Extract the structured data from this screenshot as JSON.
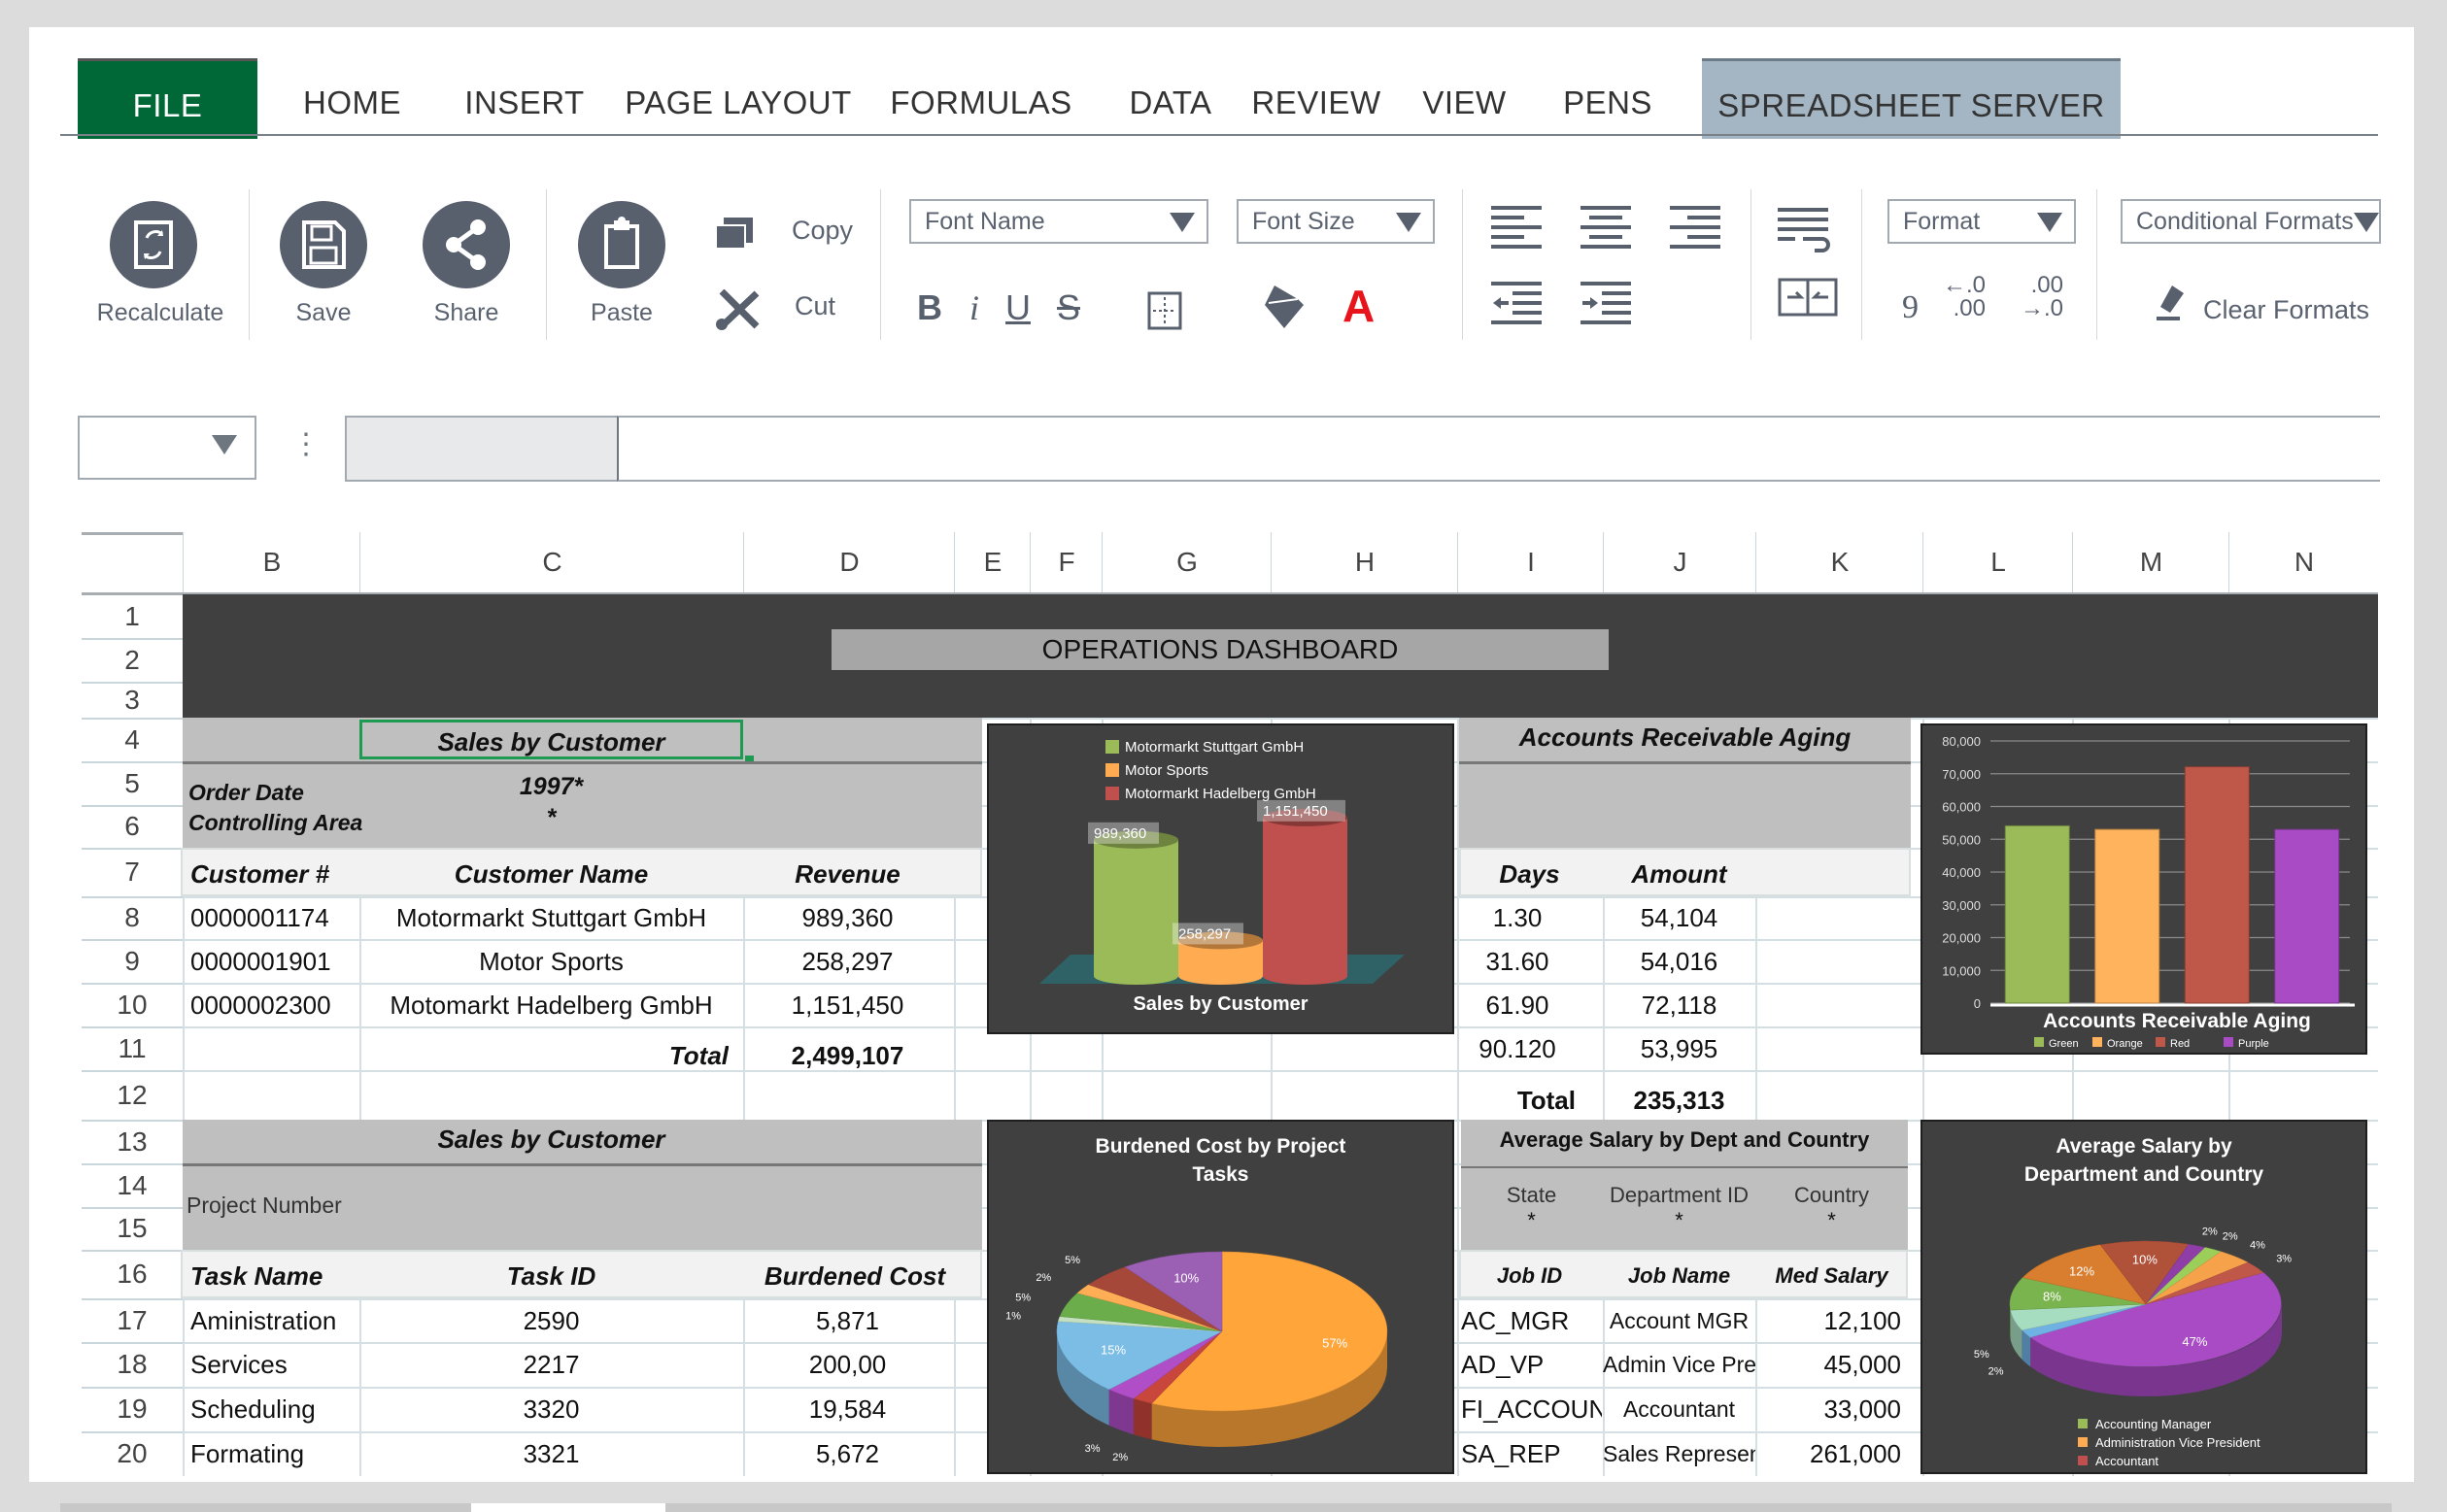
{
  "tabs": [
    {
      "label": "FILE",
      "state": "file"
    },
    {
      "label": "HOME"
    },
    {
      "label": "INSERT"
    },
    {
      "label": "PAGE LAYOUT"
    },
    {
      "label": "FORMULAS"
    },
    {
      "label": "DATA"
    },
    {
      "label": "REVIEW"
    },
    {
      "label": "VIEW"
    },
    {
      "label": "PENS"
    },
    {
      "label": "SPREADSHEET SERVER",
      "state": "active"
    }
  ],
  "ribbon": {
    "recalculate": "Recalculate",
    "save": "Save",
    "share": "Share",
    "paste": "Paste",
    "copy": "Copy",
    "cut": "Cut",
    "font_name": "Font Name",
    "font_size": "Font Size",
    "bold": "B",
    "italic": "i",
    "underline": "U",
    "strike": "S",
    "font_color": "A",
    "format": "Format",
    "conditional_formats": "Conditional Formats",
    "clear_formats": "Clear Formats",
    "comma": "9",
    "inc_decimal_top": "←.0",
    "inc_decimal_bottom": ".00",
    "dec_decimal_top": ".00",
    "dec_decimal_bottom": "→.0",
    "font_color_hex": "#e8141b",
    "icon_color": "#58606e"
  },
  "formula_bar": {
    "name_box": "",
    "formula": "",
    "dots": "⋮"
  },
  "columns": [
    "B",
    "C",
    "D",
    "E",
    "F",
    "G",
    "H",
    "I",
    "J",
    "K",
    "L",
    "M",
    "N"
  ],
  "rows": [
    "1",
    "2",
    "3",
    "4",
    "5",
    "6",
    "7",
    "8",
    "9",
    "10",
    "11",
    "12",
    "13",
    "14",
    "15",
    "16",
    "17",
    "18",
    "19",
    "20"
  ],
  "dashboard_title": "OPERATIONS DASHBOARD",
  "sales_table": {
    "title": "Sales by Customer",
    "filter_labels": [
      "Order Date",
      "Controlling Area"
    ],
    "filter_values": [
      "1997*",
      "*"
    ],
    "headers": [
      "Customer  #",
      "Customer Name",
      "Revenue"
    ],
    "rows": [
      [
        "0000001174",
        "Motormarkt Stuttgart GmbH",
        "989,360"
      ],
      [
        "0000001901",
        "Motor Sports",
        "258,297"
      ],
      [
        "0000002300",
        "Motomarkt Hadelberg GmbH",
        "1,151,450"
      ]
    ],
    "total_label": "Total",
    "total_value": "2,499,107"
  },
  "ar_table": {
    "title": "Accounts Receivable Aging",
    "headers": [
      "Days",
      "Amount"
    ],
    "rows": [
      [
        "1.30",
        "54,104"
      ],
      [
        "31.60",
        "54,016"
      ],
      [
        "61.90",
        "72,118"
      ],
      [
        "90.120",
        "53,995"
      ]
    ],
    "total_label": "Total",
    "total_value": "235,313"
  },
  "task_table": {
    "title": "Sales by Customer",
    "filter_label": "Project Number",
    "headers": [
      "Task Name",
      "Task ID",
      "Burdened Cost"
    ],
    "rows": [
      [
        "Aministration",
        "2590",
        "5,871"
      ],
      [
        "Services",
        "2217",
        "200,00"
      ],
      [
        "Scheduling",
        "3320",
        "19,584"
      ],
      [
        "Formating",
        "3321",
        "5,672"
      ]
    ]
  },
  "salary_table": {
    "title": "Average Salary by Dept and Country",
    "filter_labels": [
      "State",
      "Department ID",
      "Country"
    ],
    "filter_values": [
      "*",
      "*",
      "*"
    ],
    "headers": [
      "Job ID",
      "Job Name",
      "Med Salary"
    ],
    "rows": [
      [
        "AC_MGR",
        "Account MGR",
        "12,100"
      ],
      [
        "AD_VP",
        "Admin Vice Pre",
        "45,000"
      ],
      [
        "FI_ACCOUN",
        "Accountant",
        "33,000"
      ],
      [
        "SA_REP",
        "Sales Represen",
        "261,000"
      ]
    ]
  },
  "chart_data": [
    {
      "type": "bar",
      "style": "3d-cylinder",
      "title": "Sales by Customer",
      "categories": [
        "Motormarkt Stuttgart GmbH",
        "Motor Sports",
        "Motormarkt Hadelberg GmbH"
      ],
      "values": [
        989360,
        258297,
        1151450
      ],
      "labels": [
        "989,360",
        "258,297",
        "1,151,450"
      ],
      "colors": [
        "#9bbb59",
        "#ffab52",
        "#c0504d"
      ],
      "legend": "top",
      "ylim": [
        0,
        1200000
      ]
    },
    {
      "type": "bar",
      "title": "Accounts Receivable Aging",
      "categories": [
        "Green",
        "Orange",
        "Red",
        "Purple"
      ],
      "values": [
        54104,
        53000,
        72118,
        53000
      ],
      "colors": [
        "#9bbb59",
        "#ffb35c",
        "#c0584a",
        "#a94bc5"
      ],
      "yticks": [
        "0",
        "10,000",
        "20,000",
        "30,000",
        "40,000",
        "50,000",
        "60,000",
        "70,000",
        "80,000"
      ],
      "ylim": [
        0,
        80000
      ],
      "grid": true,
      "legend": "bottom"
    },
    {
      "type": "pie",
      "style": "3d",
      "title": "Burdened Cost by Project Tasks",
      "values": [
        57,
        2,
        3,
        15,
        1,
        5,
        2,
        5,
        10
      ],
      "labels": [
        "57%",
        "2%",
        "3%",
        "15%",
        "1%",
        "5%",
        "2%",
        "5%",
        "10%"
      ],
      "colors": [
        "#ffa53a",
        "#c8463c",
        "#b04ec8",
        "#7cbde6",
        "#c5e0c0",
        "#6aad4a",
        "#ffae55",
        "#a5483a",
        "#9b5fb4"
      ]
    },
    {
      "type": "pie",
      "style": "3d",
      "title": "Average Salary by Department and Country",
      "values": [
        47,
        2,
        5,
        8,
        12,
        10,
        2,
        2,
        4,
        3
      ],
      "labels": [
        "47%",
        "2%",
        "5%",
        "8%",
        "12%",
        "10%",
        "2%",
        "2%",
        "4%",
        "3%"
      ],
      "colors": [
        "#a94bc5",
        "#6fb1e3",
        "#a6dcc0",
        "#7ab44e",
        "#d97e2e",
        "#b0513a",
        "#8e3ea6",
        "#9bcf5a",
        "#f6a24a",
        "#c0584a"
      ],
      "legend_entries": [
        "Accounting Manager",
        "Administration Vice President",
        "Accountant"
      ],
      "legend_colors": [
        "#9bbb59",
        "#ffab52",
        "#c0504d"
      ],
      "legend": "bottom"
    }
  ]
}
